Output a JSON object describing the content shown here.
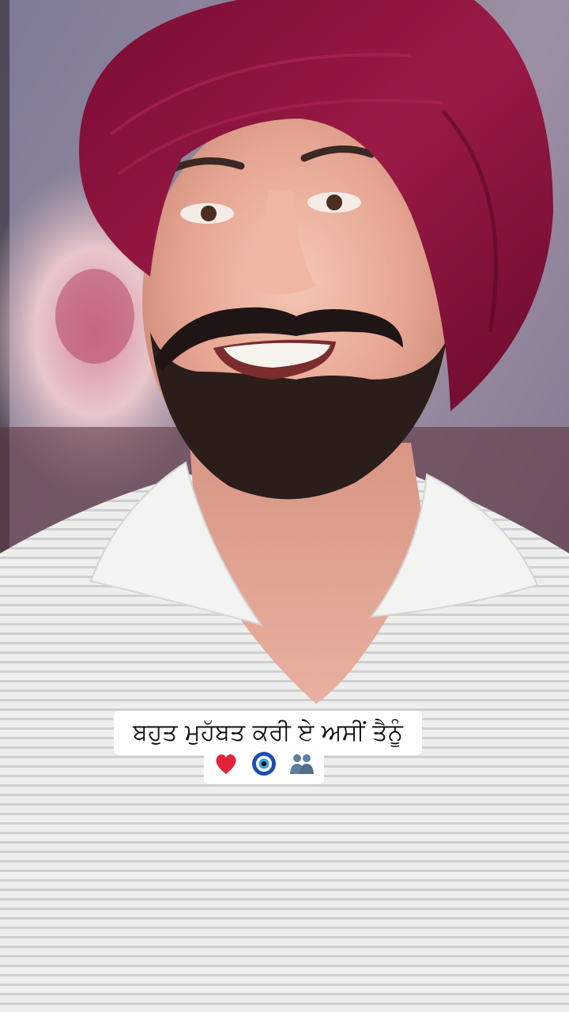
{
  "caption": {
    "line1": "ਬਹੁਤ ਮੁਹੱਬਤ ਕਰੀ ਏ ਅਸੀਂ ਤੈਨੂੰ",
    "emojis": [
      "heart-icon",
      "nazar-amulet-icon",
      "couple-silhouette-icon"
    ]
  },
  "colors": {
    "turban": "#8a1238",
    "shirt": "#ececea",
    "shirt_stripe": "#c9c9cd",
    "background": "#8f8a99"
  }
}
